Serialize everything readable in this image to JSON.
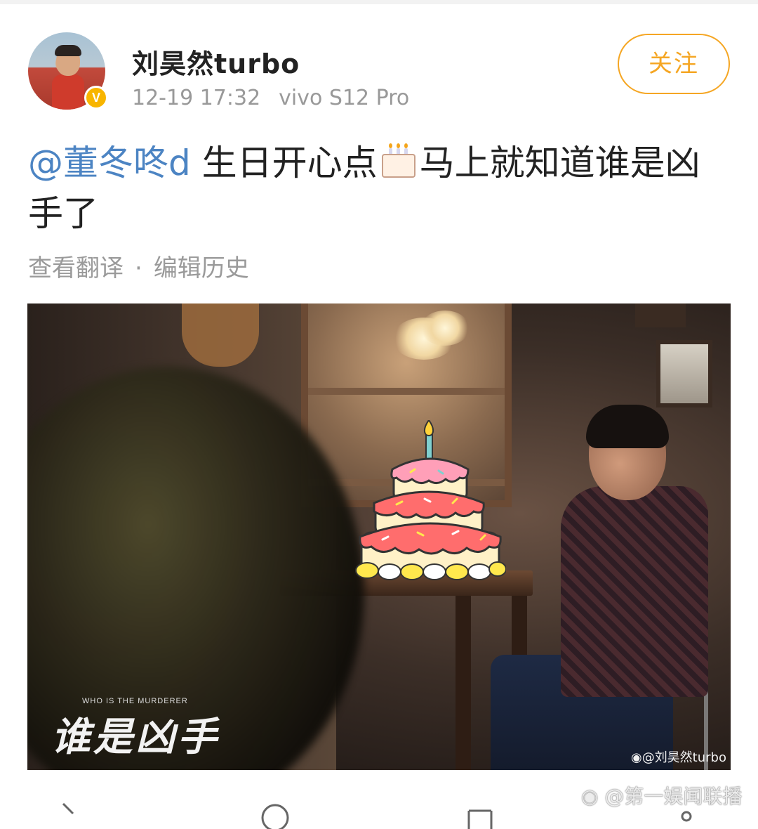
{
  "post": {
    "author": "刘昊然turbo",
    "time": "12-19 17:32",
    "device": "vivo S12 Pro",
    "follow_label": "关注",
    "verified_badge": "V",
    "mention": "@董冬咚d",
    "text_part1": " 生日开心点",
    "text_part2": "马上就知道谁是凶手了",
    "translate_label": "查看翻译",
    "separator": "·",
    "edit_history_label": "编辑历史"
  },
  "image": {
    "small_caption": "WHO IS THE MURDERER",
    "title": "谁是凶手",
    "watermark": "@刘昊然turbo"
  },
  "page_watermark": "@第一娱闻联播",
  "colors": {
    "accent_orange": "#f5a623",
    "mention_blue": "#4c84c3",
    "meta_gray": "#999999",
    "verified_gold": "#f8b500"
  },
  "icons": [
    "verified-badge-icon",
    "birthday-cake-icon",
    "weibo-logo-icon",
    "repost-icon",
    "comment-icon",
    "like-icon"
  ]
}
